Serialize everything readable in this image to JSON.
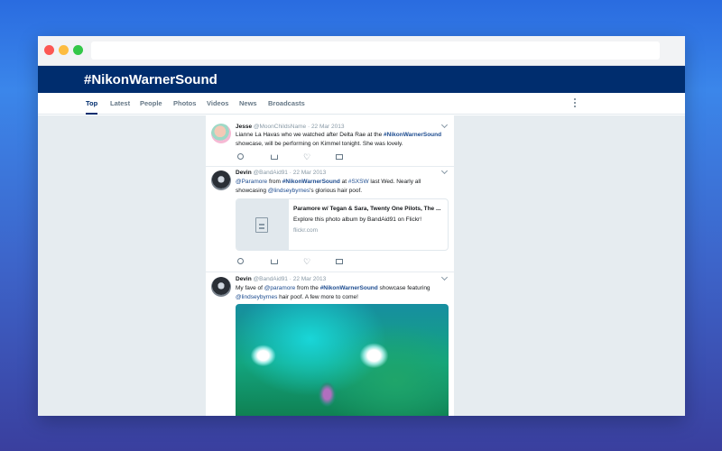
{
  "page": {
    "title": "#NikonWarnerSound"
  },
  "tabs": [
    {
      "label": "Top",
      "active": true
    },
    {
      "label": "Latest"
    },
    {
      "label": "People"
    },
    {
      "label": "Photos"
    },
    {
      "label": "Videos"
    },
    {
      "label": "News"
    },
    {
      "label": "Broadcasts"
    }
  ],
  "tweets": [
    {
      "name": "Jesse",
      "handle": "@MoonChildsName",
      "date": "· 22 Mar 2013",
      "text_1": "Lianne La Havas who we watched after Delta Rae at the ",
      "hashtag": "#NikonWarnerSound",
      "text_2": " showcase, will be performing on Kimmel tonight. She was lovely."
    },
    {
      "name": "Devin",
      "handle": "@BandAid91",
      "date": "· 22 Mar 2013",
      "mention_1": "@Paramore",
      "text_1": " from ",
      "hashtag": "#NikonWarnerSound",
      "text_2": " at ",
      "hashtag_2": "#SXSW",
      "text_3": " last Wed. Nearly all showcasing ",
      "mention_2": "@lindseybyrnes",
      "text_4": "'s glorious hair poof.",
      "card": {
        "title": "Paramore w/ Tegan & Sara, Twenty One Pilots, The ...",
        "description": "Explore this photo album by BandAid91 on Flickr!",
        "domain": "flickr.com"
      }
    },
    {
      "name": "Devin",
      "handle": "@BandAid91",
      "date": "· 22 Mar 2013",
      "text_1": "My fave of ",
      "mention_1": "@paramore",
      "text_2": " from the ",
      "hashtag": "#NikonWarnerSound",
      "text_3": " showcase featuring ",
      "mention_2": "@lindseybyrnes",
      "text_4": " hair poof. A few more to come!"
    }
  ],
  "icons": {
    "reply": "reply-icon",
    "retweet": "retweet-icon",
    "like": "heart-icon",
    "message": "envelope-icon",
    "more": "more-vertical-icon",
    "caret": "chevron-down-icon",
    "card_placeholder": "document-icon"
  },
  "colors": {
    "header": "#002d6e",
    "link": "#1c4b8f",
    "muted": "#8899a6"
  }
}
